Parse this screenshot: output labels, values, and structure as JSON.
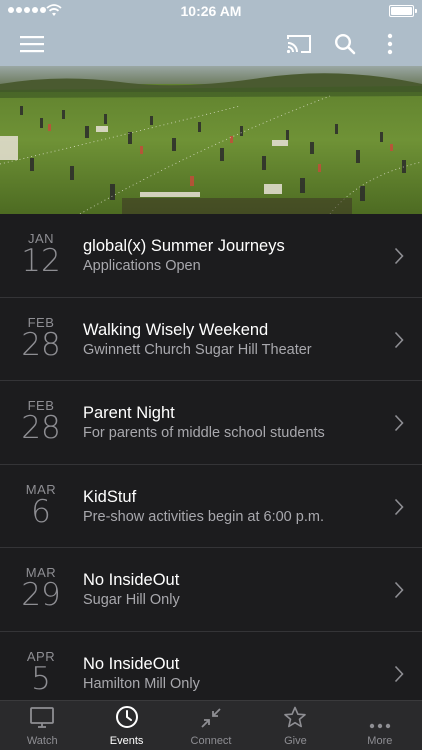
{
  "status_bar": {
    "time": "10:26 AM",
    "signal_icon": "signal-dots-icon",
    "wifi_icon": "wifi-icon",
    "battery_icon": "battery-icon",
    "battery_level": 1.0
  },
  "nav_bar": {
    "background": "#aebdc9",
    "menu_icon": "hamburger-menu-icon",
    "cast_icon": "cast-icon",
    "search_icon": "search-icon",
    "more_icon": "more-vertical-icon"
  },
  "events": [
    {
      "month": "JAN",
      "day": "12",
      "title": "global(x) Summer Journeys",
      "subtitle": "Applications Open"
    },
    {
      "month": "FEB",
      "day": "28",
      "title": "Walking Wisely Weekend",
      "subtitle": "Gwinnett Church Sugar Hill Theater"
    },
    {
      "month": "FEB",
      "day": "28",
      "title": "Parent Night",
      "subtitle": "For parents of middle school students"
    },
    {
      "month": "MAR",
      "day": "6",
      "title": "KidStuf",
      "subtitle": "Pre-show activities begin at 6:00 p.m."
    },
    {
      "month": "MAR",
      "day": "29",
      "title": "No InsideOut",
      "subtitle": "Sugar Hill Only"
    },
    {
      "month": "APR",
      "day": "5",
      "title": "No InsideOut",
      "subtitle": "Hamilton Mill Only"
    }
  ],
  "tab_bar": {
    "tabs": [
      {
        "label": "Watch",
        "icon": "tv-icon",
        "active": false
      },
      {
        "label": "Events",
        "icon": "clock-icon",
        "active": true
      },
      {
        "label": "Connect",
        "icon": "connect-arrows-icon",
        "active": false
      },
      {
        "label": "Give",
        "icon": "star-icon",
        "active": false
      },
      {
        "label": "More",
        "icon": "more-horizontal-icon",
        "active": false
      }
    ]
  }
}
